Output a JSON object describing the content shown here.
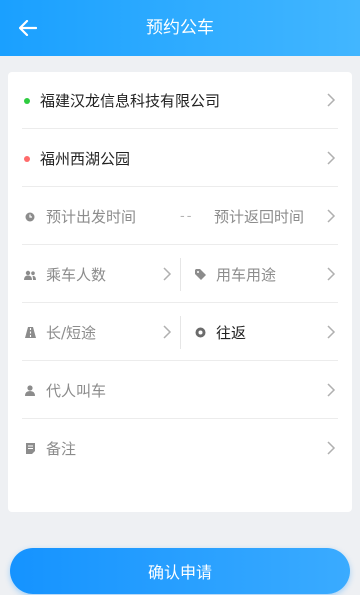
{
  "header": {
    "title": "预约公车",
    "back_icon": "arrow-left-icon"
  },
  "form": {
    "from": {
      "value": "福建汉龙信息科技有限公司",
      "dot_color": "#2ecc40"
    },
    "to": {
      "value": "福州西湖公园",
      "dot_color": "#ff6b6b"
    },
    "departure_time": {
      "placeholder": "预计出发时间"
    },
    "separator": "--",
    "return_time": {
      "placeholder": "预计返回时间"
    },
    "passengers": {
      "placeholder": "乘车人数"
    },
    "purpose": {
      "placeholder": "用车用途"
    },
    "distance": {
      "placeholder": "长/短途"
    },
    "trip_type": {
      "value": "往返"
    },
    "proxy": {
      "placeholder": "代人叫车"
    },
    "remarks": {
      "placeholder": "备注"
    }
  },
  "submit_label": "确认申请",
  "colors": {
    "accent": "#1aa0ff",
    "icon_gray": "#8c8c8c",
    "chevron": "#b0b0b0"
  }
}
